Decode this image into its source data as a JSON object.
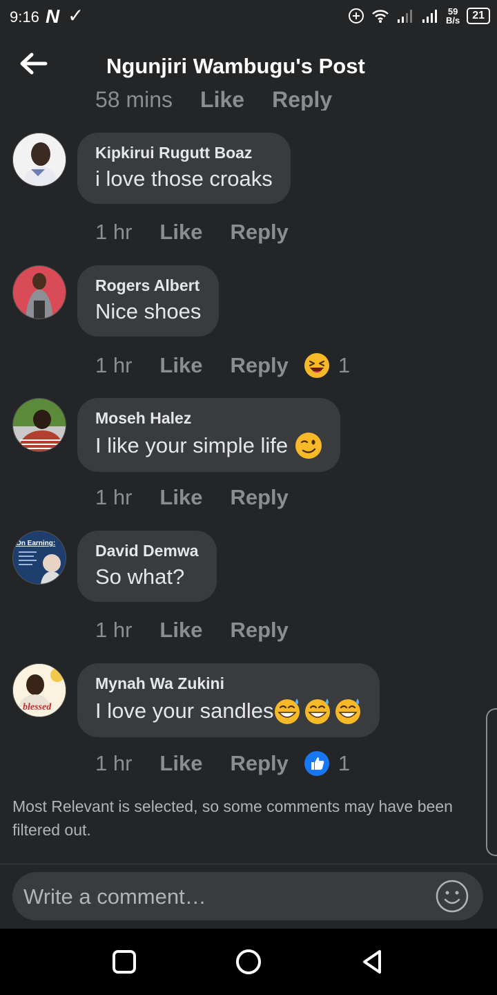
{
  "status": {
    "time": "9:16",
    "speed_top": "59",
    "speed_bottom": "B/s",
    "battery": "21"
  },
  "header": {
    "title": "Ngunjiri Wambugu's Post"
  },
  "clipped_meta": {
    "time": "58 mins",
    "like": "Like",
    "reply": "Reply"
  },
  "comments": [
    {
      "author": "Kipkirui Rugutt Boaz",
      "text": "i love those croaks",
      "time": "1 hr",
      "like": "Like",
      "reply": "Reply"
    },
    {
      "author": "Rogers Albert",
      "text": "Nice shoes",
      "time": "1 hr",
      "like": "Like",
      "reply": "Reply",
      "reaction": "laughing-emoji",
      "reaction_count": "1"
    },
    {
      "author": "Moseh Halez",
      "text": "I like your simple life",
      "time": "1 hr",
      "like": "Like",
      "reply": "Reply"
    },
    {
      "author": "David Demwa",
      "text": "So what?",
      "time": "1 hr",
      "like": "Like",
      "reply": "Reply"
    },
    {
      "author": "Mynah Wa Zukini",
      "text": "I love your sandles",
      "time": "1 hr",
      "like": "Like",
      "reply": "Reply",
      "reaction": "thumbs-up",
      "reaction_count": "1"
    }
  ],
  "avatar_texts": {
    "david": "On Earning:",
    "mynah": "blessed"
  },
  "notice": "Most Relevant is selected, so some comments may have been filtered out.",
  "composer": {
    "placeholder": "Write a comment…"
  },
  "colors": {
    "background": "#242526",
    "bubble": "#3a3b3c",
    "meta": "#8a8d91",
    "like_blue": "#1877f2"
  }
}
